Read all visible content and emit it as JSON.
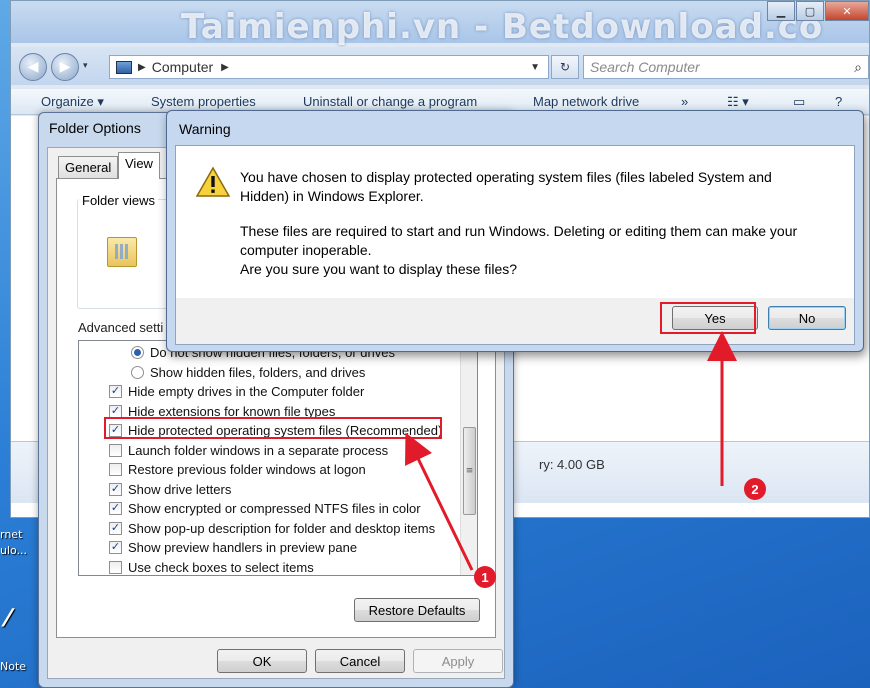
{
  "explorer": {
    "watermark": "Taimienphi.vn - Betdownload.co",
    "breadcrumb": "Computer",
    "search_placeholder": "Search Computer",
    "toolbar": {
      "organize": "Organize ▾",
      "system_properties": "System properties",
      "uninstall": "Uninstall or change a program",
      "map_drive": "Map network drive",
      "more": "»"
    },
    "memory": "ry: 4.00 GB"
  },
  "desktop": {
    "icon1_label_a": "rnet",
    "icon1_label_b": "ulo...",
    "icon2_label": "Note"
  },
  "folder_options": {
    "title": "Folder Options",
    "tab_general": "General",
    "tab_view": "View",
    "folder_views_legend": "Folder views",
    "partial_text": "y",
    "advanced_label": "Advanced setti",
    "items": [
      {
        "type": "radio",
        "checked": true,
        "label": "Do not show hidden files, folders, or drives"
      },
      {
        "type": "radio",
        "checked": false,
        "label": "Show hidden files, folders, and drives"
      },
      {
        "type": "check",
        "checked": true,
        "label": "Hide empty drives in the Computer folder"
      },
      {
        "type": "check",
        "checked": true,
        "label": "Hide extensions for known file types"
      },
      {
        "type": "check",
        "checked": true,
        "label": "Hide protected operating system files (Recommended)"
      },
      {
        "type": "check",
        "checked": false,
        "label": "Launch folder windows in a separate process"
      },
      {
        "type": "check",
        "checked": false,
        "label": "Restore previous folder windows at logon"
      },
      {
        "type": "check",
        "checked": true,
        "label": "Show drive letters"
      },
      {
        "type": "check",
        "checked": true,
        "label": "Show encrypted or compressed NTFS files in color"
      },
      {
        "type": "check",
        "checked": true,
        "label": "Show pop-up description for folder and desktop items"
      },
      {
        "type": "check",
        "checked": true,
        "label": "Show preview handlers in preview pane"
      },
      {
        "type": "check",
        "checked": false,
        "label": "Use check boxes to select items"
      }
    ],
    "restore_defaults": "Restore Defaults",
    "ok": "OK",
    "cancel": "Cancel",
    "apply": "Apply"
  },
  "warning": {
    "title": "Warning",
    "line1": "You have chosen to display protected operating system files (files labeled System and",
    "line2": "Hidden) in Windows Explorer.",
    "line3": "These files are required to start and run Windows. Deleting or editing them can make your",
    "line4": "computer inoperable.",
    "line5": "Are you sure you want to display these files?",
    "yes": "Yes",
    "no": "No"
  },
  "annotations": {
    "step1": "1",
    "step2": "2",
    "highlight_color": "#e21b2a"
  },
  "colors": {
    "desktop_blue": "#2b7fd6",
    "dialog_frame": "#c5d8ef",
    "accent_red": "#e21b2a"
  }
}
